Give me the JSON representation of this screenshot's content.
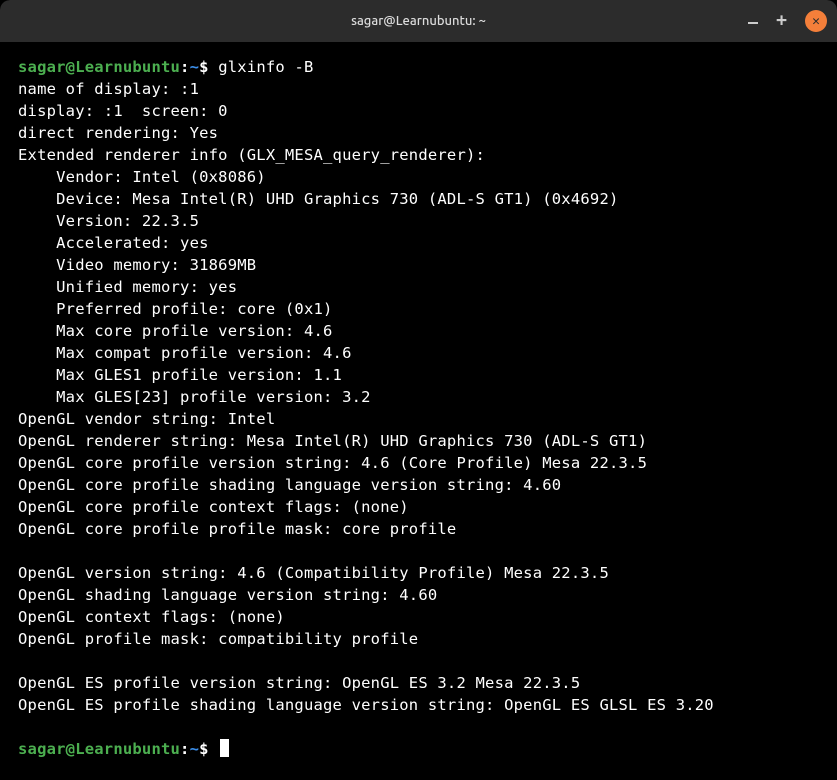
{
  "titlebar": {
    "title": "sagar@Learnubuntu: ~"
  },
  "prompt": {
    "user_host": "sagar@Learnubuntu",
    "separator": ":",
    "path": "~",
    "symbol": "$"
  },
  "command": "glxinfo -B",
  "output_lines": [
    "name of display: :1",
    "display: :1  screen: 0",
    "direct rendering: Yes",
    "Extended renderer info (GLX_MESA_query_renderer):",
    "    Vendor: Intel (0x8086)",
    "    Device: Mesa Intel(R) UHD Graphics 730 (ADL-S GT1) (0x4692)",
    "    Version: 22.3.5",
    "    Accelerated: yes",
    "    Video memory: 31869MB",
    "    Unified memory: yes",
    "    Preferred profile: core (0x1)",
    "    Max core profile version: 4.6",
    "    Max compat profile version: 4.6",
    "    Max GLES1 profile version: 1.1",
    "    Max GLES[23] profile version: 3.2",
    "OpenGL vendor string: Intel",
    "OpenGL renderer string: Mesa Intel(R) UHD Graphics 730 (ADL-S GT1)",
    "OpenGL core profile version string: 4.6 (Core Profile) Mesa 22.3.5",
    "OpenGL core profile shading language version string: 4.60",
    "OpenGL core profile context flags: (none)",
    "OpenGL core profile profile mask: core profile",
    "",
    "OpenGL version string: 4.6 (Compatibility Profile) Mesa 22.3.5",
    "OpenGL shading language version string: 4.60",
    "OpenGL context flags: (none)",
    "OpenGL profile mask: compatibility profile",
    "",
    "OpenGL ES profile version string: OpenGL ES 3.2 Mesa 22.3.5",
    "OpenGL ES profile shading language version string: OpenGL ES GLSL ES 3.20"
  ]
}
